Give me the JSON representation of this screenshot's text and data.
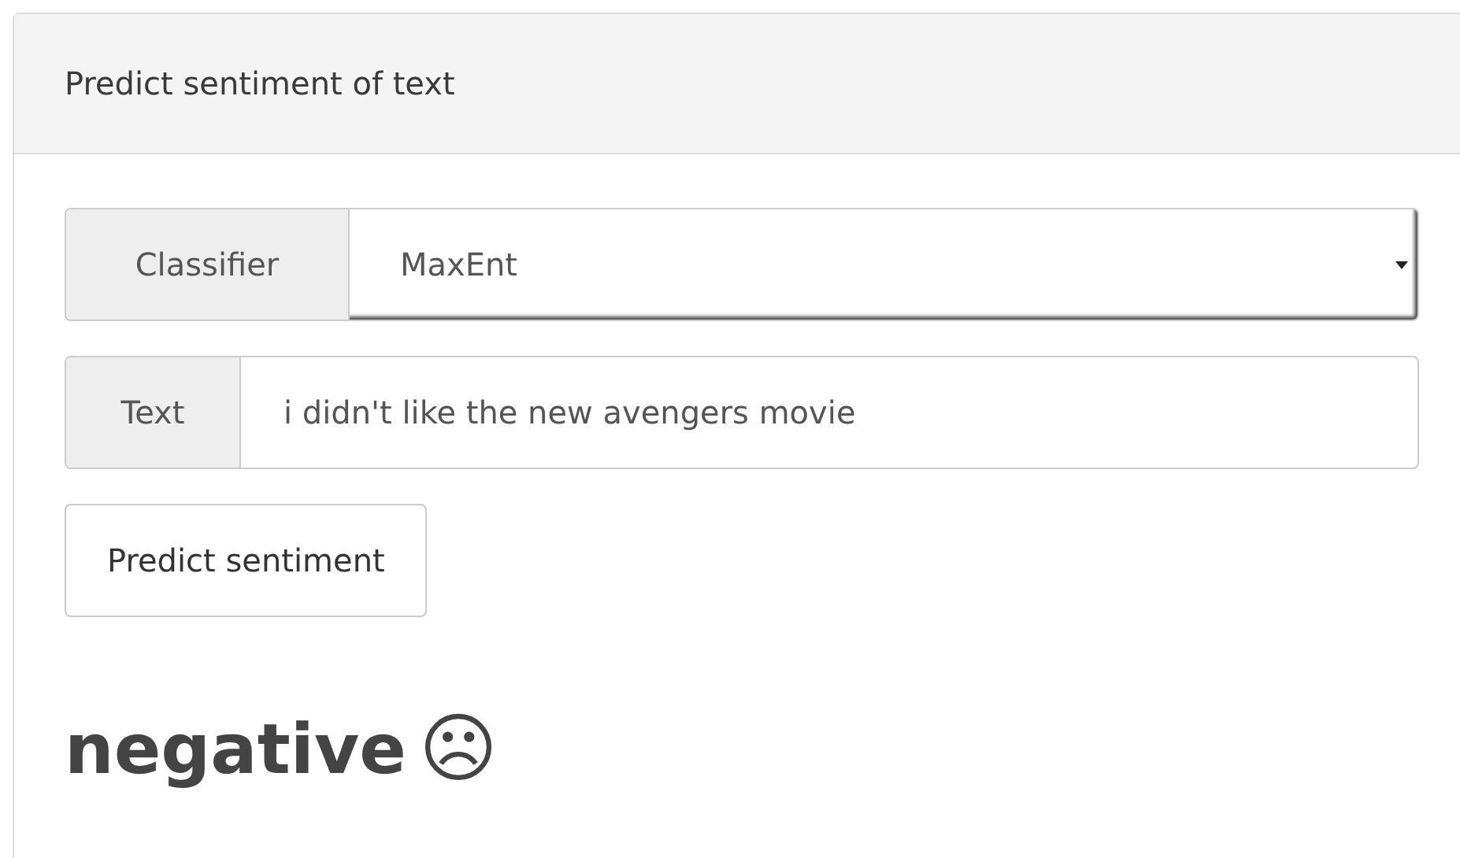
{
  "panel": {
    "title": "Predict sentiment of text"
  },
  "classifier": {
    "label": "Classifier",
    "value": "MaxEnt"
  },
  "text_input": {
    "label": "Text",
    "value": "i didn't like the new avengers movie"
  },
  "button": {
    "label": "Predict sentiment"
  },
  "result": {
    "label": "negative",
    "symbol": "☹"
  }
}
